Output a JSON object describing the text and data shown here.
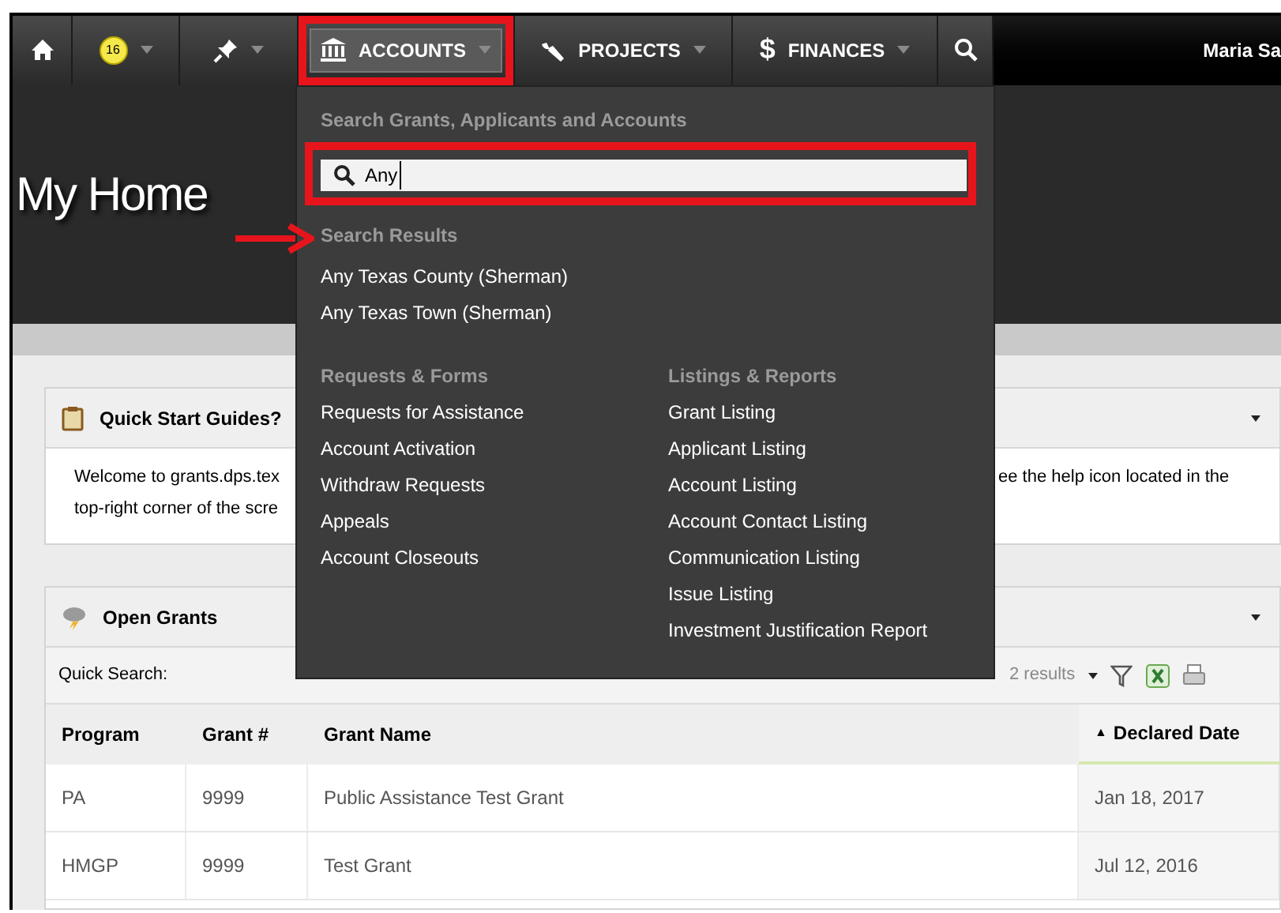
{
  "navbar": {
    "items": [
      {
        "kind": "home",
        "selected": false
      },
      {
        "kind": "badge",
        "badge": "16",
        "selected": false
      },
      {
        "kind": "pin",
        "selected": false
      },
      {
        "kind": "bank",
        "label": "ACCOUNTS",
        "selected": true
      },
      {
        "kind": "wrench",
        "label": "PROJECTS",
        "selected": false
      },
      {
        "kind": "glyph",
        "glyph": "$",
        "label": "FINANCES",
        "selected": false
      },
      {
        "kind": "search",
        "selected": false
      }
    ],
    "user": "Maria Sa"
  },
  "page_title": "My Home",
  "accounts_menu": {
    "search_heading": "Search Grants, Applicants and Accounts",
    "search_value": "Any",
    "results_heading": "Search Results",
    "results": [
      "Any Texas County (Sherman)",
      "Any Texas Town (Sherman)"
    ],
    "columns": [
      {
        "heading": "Requests & Forms",
        "items": [
          "Requests for Assistance",
          "Account Activation",
          "Withdraw Requests",
          "Appeals",
          "Account Closeouts"
        ]
      },
      {
        "heading": "Listings & Reports",
        "items": [
          "Grant Listing",
          "Applicant Listing",
          "Account Listing",
          "Account Contact Listing",
          "Communication Listing",
          "Issue Listing",
          "Investment Justification Report"
        ]
      }
    ]
  },
  "quick_start": {
    "title": "Quick Start Guides?",
    "text_left": [
      "Welcome to grants.dps.tex",
      "top-right corner of the scre"
    ],
    "text_right": "ee the help icon located in the"
  },
  "open_grants": {
    "title": "Open Grants",
    "quick_search_label": "Quick Search:",
    "results": "2 results",
    "columns": [
      {
        "label": "Program",
        "sorted": false
      },
      {
        "label": "Grant #",
        "sorted": false
      },
      {
        "label": "Grant Name",
        "sorted": false
      },
      {
        "label": "Declared Date",
        "sorted": true,
        "sort_mark": "▲"
      }
    ],
    "rows": [
      [
        "PA",
        "9999",
        "Public Assistance Test Grant",
        "Jan 18, 2017"
      ],
      [
        "HMGP",
        "9999",
        "Test Grant",
        "Jul 12, 2016"
      ]
    ]
  }
}
